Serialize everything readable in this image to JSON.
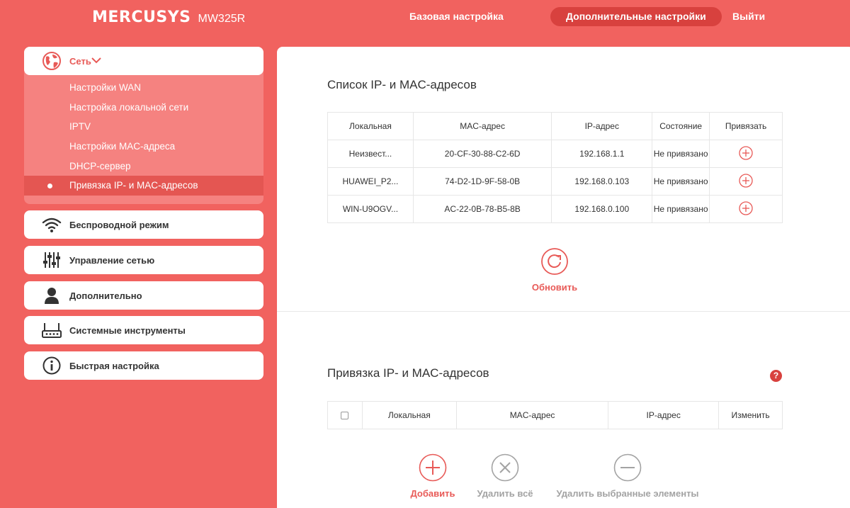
{
  "header": {
    "brand": "MERCUSYS",
    "model": "MW325R",
    "nav": {
      "basic": "Базовая настройка",
      "advanced": "Дополнительные настройки",
      "logout": "Выйти"
    }
  },
  "sidebar": {
    "network": {
      "label": "Сеть",
      "icon": "globe-icon",
      "items": [
        {
          "label": "Настройки WAN"
        },
        {
          "label": "Настройка локальной сети"
        },
        {
          "label": "IPTV"
        },
        {
          "label": "Настройки MAC-адреса"
        },
        {
          "label": "DHCP-сервер"
        },
        {
          "label": "Привязка IP- и MAC-адресов",
          "active": true
        }
      ]
    },
    "groups": [
      {
        "label": "Беспроводной режим",
        "icon": "wifi-icon"
      },
      {
        "label": "Управление сетью",
        "icon": "sliders-icon"
      },
      {
        "label": "Дополнительно",
        "icon": "user-icon"
      },
      {
        "label": "Системные инструменты",
        "icon": "router-icon"
      },
      {
        "label": "Быстрая настройка",
        "icon": "info-icon"
      }
    ]
  },
  "ip_mac_list": {
    "title": "Список IP- и MAC-адресов",
    "columns": [
      "Локальная",
      "MAC-адрес",
      "IP-адрес",
      "Состояние",
      "Привязать"
    ],
    "rows": [
      {
        "name": "Неизвест...",
        "mac": "20-CF-30-88-C2-6D",
        "ip": "192.168.1.1",
        "status": "Не привязано"
      },
      {
        "name": "HUAWEI_P2...",
        "mac": "74-D2-1D-9F-58-0B",
        "ip": "192.168.0.103",
        "status": "Не привязано"
      },
      {
        "name": "WIN-U9OGV...",
        "mac": "AC-22-0B-78-B5-8B",
        "ip": "192.168.0.100",
        "status": "Не привязано"
      }
    ],
    "refresh_label": "Обновить"
  },
  "binding": {
    "title": "Привязка IP- и MAC-адресов",
    "help": "?",
    "columns": [
      "Локальная",
      "MAC-адрес",
      "IP-адрес",
      "Изменить"
    ],
    "actions": {
      "add": "Добавить",
      "delete_all": "Удалить всё",
      "delete_selected": "Удалить выбранные элементы"
    }
  },
  "colors": {
    "accent": "#f1625f",
    "accent_dark": "#d8413e",
    "icon_red": "#e85a57",
    "icon_grey": "#a3a3a3"
  }
}
